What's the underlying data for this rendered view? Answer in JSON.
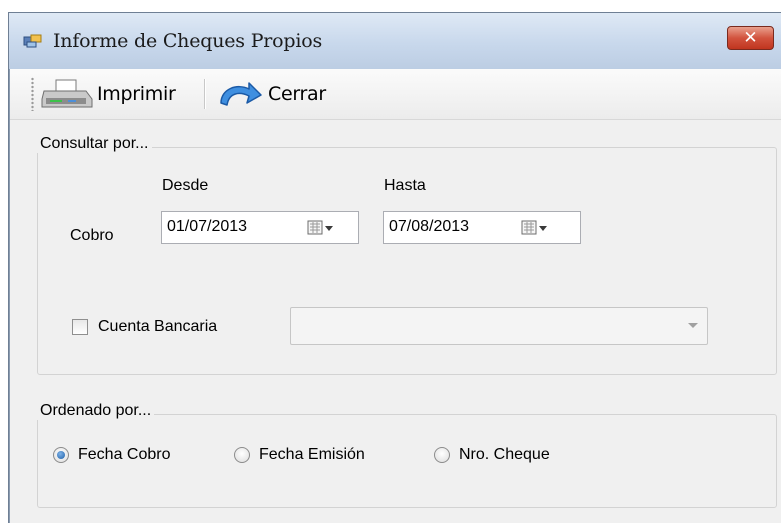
{
  "window": {
    "title": "Informe de Cheques Propios",
    "close_label": "✕"
  },
  "toolbar": {
    "print_label": "Imprimir",
    "close_label": "Cerrar"
  },
  "query_group": {
    "legend": "Consultar por...",
    "from_label": "Desde",
    "to_label": "Hasta",
    "row_label": "Cobro",
    "from_value": "01/07/2013",
    "to_value": "07/08/2013",
    "bank_account_label": "Cuenta Bancaria",
    "bank_account_checked": false,
    "bank_account_value": ""
  },
  "order_group": {
    "legend": "Ordenado por...",
    "options": [
      {
        "label": "Fecha Cobro",
        "selected": true
      },
      {
        "label": "Fecha Emisión",
        "selected": false
      },
      {
        "label": "Nro. Cheque",
        "selected": false
      }
    ]
  }
}
